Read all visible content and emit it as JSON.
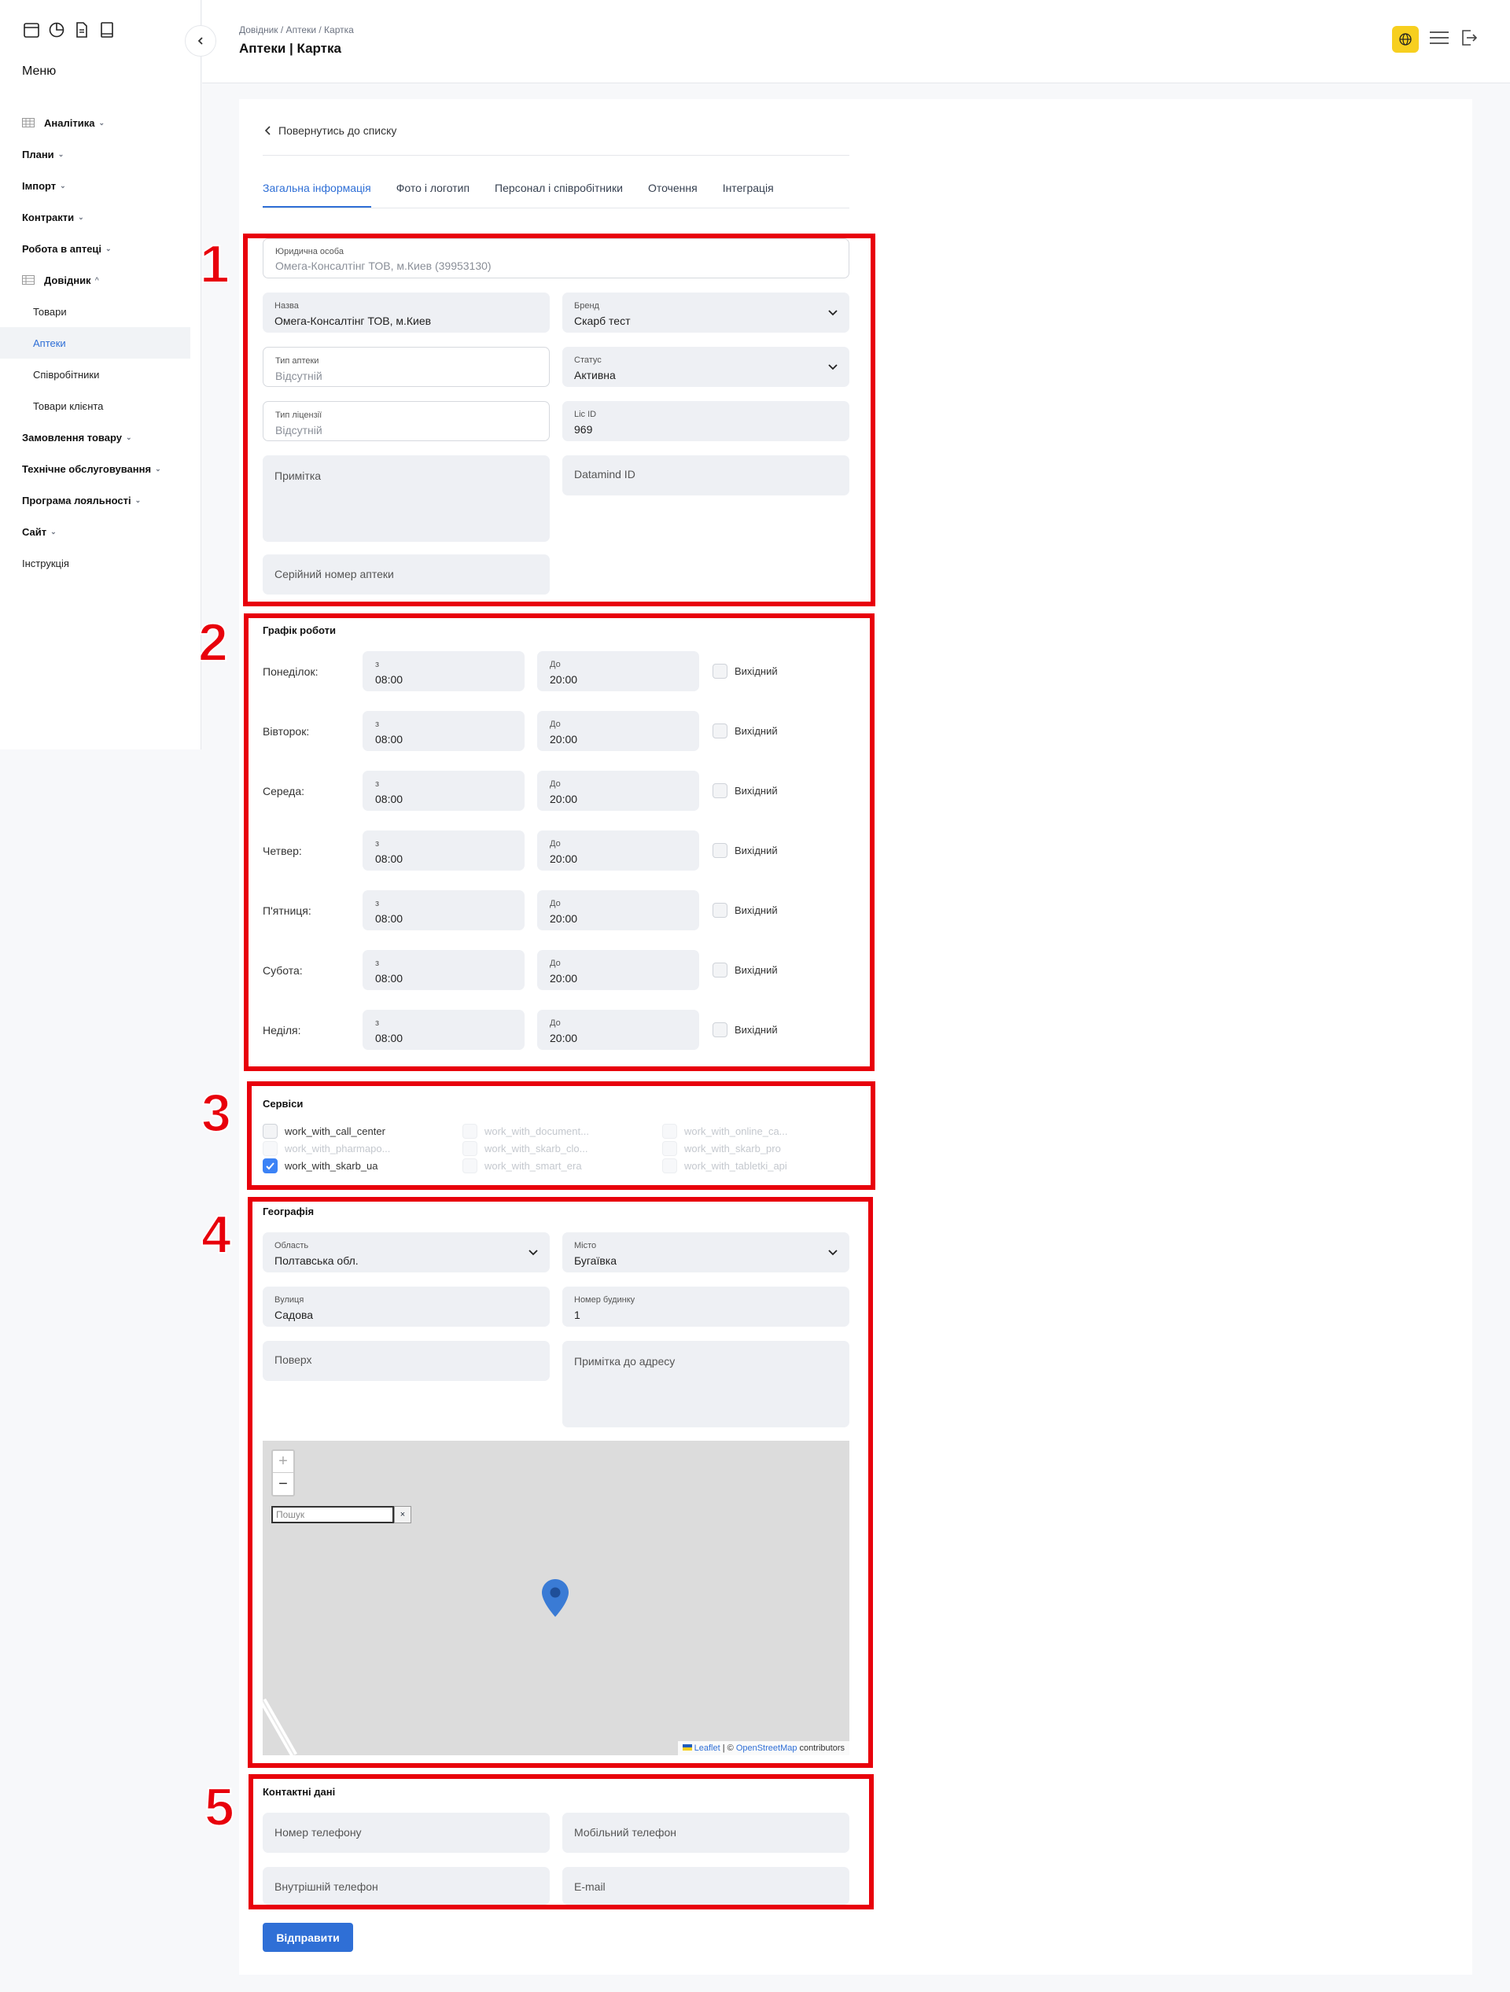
{
  "sidebar": {
    "menu_title": "Меню",
    "items": [
      {
        "label": "Аналітика"
      },
      {
        "label": "Плани"
      },
      {
        "label": "Імпорт"
      },
      {
        "label": "Контракти"
      },
      {
        "label": "Робота в аптеці"
      },
      {
        "label": "Довідник"
      },
      {
        "label": "Товари"
      },
      {
        "label": "Аптеки"
      },
      {
        "label": "Співробітники"
      },
      {
        "label": "Товари клієнта"
      },
      {
        "label": "Замовлення товару"
      },
      {
        "label": "Технічне обслуговування"
      },
      {
        "label": "Програма лояльності"
      },
      {
        "label": "Сайт"
      },
      {
        "label": "Інструкція"
      }
    ]
  },
  "header": {
    "breadcrumbs": "Довідник / Аптеки / Картка",
    "title": "Аптеки | Картка"
  },
  "back_link": "Повернутись до списку",
  "tabs": [
    {
      "label": "Загальна інформація"
    },
    {
      "label": "Фото і логотип"
    },
    {
      "label": "Персонал і співробітники"
    },
    {
      "label": "Оточення"
    },
    {
      "label": "Інтеграція"
    }
  ],
  "annotations": [
    "1",
    "2",
    "3",
    "4",
    "5"
  ],
  "general": {
    "legal_entity": {
      "label": "Юридична особа",
      "value": "Омега-Консалтінг ТОВ, м.Киев (39953130)"
    },
    "name": {
      "label": "Назва",
      "value": "Омега-Консалтінг ТОВ, м.Киев"
    },
    "brand": {
      "label": "Бренд",
      "value": "Скарб тест"
    },
    "pharmacy_type": {
      "label": "Тип аптеки",
      "value": "Відсутній"
    },
    "status": {
      "label": "Статус",
      "value": "Активна"
    },
    "license_type": {
      "label": "Тип ліцензії",
      "value": "Відсутній"
    },
    "lic_id": {
      "label": "Lic ID",
      "value": "969"
    },
    "note": {
      "placeholder": "Примітка"
    },
    "datamind": {
      "placeholder": "Datamind ID"
    },
    "serial": {
      "placeholder": "Серійний номер аптеки"
    }
  },
  "schedule": {
    "title": "Графік роботи",
    "from_label": "з",
    "to_label": "До",
    "dayoff_label": "Вихідний",
    "days": [
      {
        "name": "Понеділок:",
        "from": "08:00",
        "to": "20:00"
      },
      {
        "name": "Вівторок:",
        "from": "08:00",
        "to": "20:00"
      },
      {
        "name": "Середа:",
        "from": "08:00",
        "to": "20:00"
      },
      {
        "name": "Четвер:",
        "from": "08:00",
        "to": "20:00"
      },
      {
        "name": "П'ятниця:",
        "from": "08:00",
        "to": "20:00"
      },
      {
        "name": "Субота:",
        "from": "08:00",
        "to": "20:00"
      },
      {
        "name": "Неділя:",
        "from": "08:00",
        "to": "20:00"
      }
    ]
  },
  "services": {
    "title": "Сервіси",
    "items": [
      {
        "label": "work_with_call_center",
        "state": "off"
      },
      {
        "label": "work_with_document...",
        "state": "disabled"
      },
      {
        "label": "work_with_online_ca...",
        "state": "disabled"
      },
      {
        "label": "work_with_pharmapo...",
        "state": "disabled"
      },
      {
        "label": "work_with_skarb_clo...",
        "state": "disabled"
      },
      {
        "label": "work_with_skarb_pro",
        "state": "disabled"
      },
      {
        "label": "work_with_skarb_ua",
        "state": "on"
      },
      {
        "label": "work_with_smart_era",
        "state": "disabled"
      },
      {
        "label": "work_with_tabletki_api",
        "state": "disabled"
      }
    ]
  },
  "geo": {
    "title": "Географія",
    "region": {
      "label": "Область",
      "value": "Полтавська обл."
    },
    "city": {
      "label": "Місто",
      "value": "Бугаївка"
    },
    "street": {
      "label": "Вулиця",
      "value": "Садова"
    },
    "house": {
      "label": "Номер будинку",
      "value": "1"
    },
    "floor": {
      "placeholder": "Поверх"
    },
    "address_note": {
      "placeholder": "Примітка до адресу"
    },
    "map": {
      "zoom_in": "+",
      "zoom_out": "−",
      "search_placeholder": "Пошук",
      "search_clear": "×",
      "attr_leaflet": "Leaflet",
      "attr_sep": " | © ",
      "attr_osm": "OpenStreetMap",
      "attr_tail": " contributors"
    }
  },
  "contacts": {
    "title": "Контактні дані",
    "phone": "Номер телефону",
    "mobile": "Мобільний телефон",
    "internal": "Внутрішній телефон",
    "email": "E-mail"
  },
  "submit_label": "Відправити",
  "colors": {
    "accent": "#2f6fd6",
    "annotation": "#e8000b",
    "globe": "#f7cf1f"
  }
}
